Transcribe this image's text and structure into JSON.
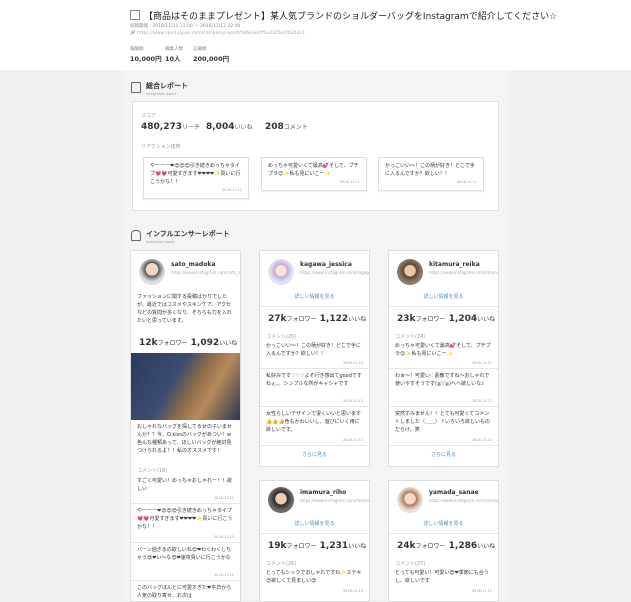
{
  "header": {
    "title": "【商品はそのままプレゼント】某人気ブランドのショルダーバッグをInstagramで紹介してください☆",
    "period": "投稿期間 : 2016/11/11 11:00 ～ 2016/11/12 22:00",
    "url": "🔗 https://www.spirit-japan.com/company/report/586e3e2ff5e2305e1fb20d11",
    "stats": [
      {
        "label": "報酬額",
        "value": "10,000円"
      },
      {
        "label": "募集人数",
        "value": "10人"
      },
      {
        "label": "応募額",
        "value": "200,000円"
      }
    ]
  },
  "summary": {
    "title": "総合レポート",
    "subtitle": "Integrated report",
    "score_label": "スコア",
    "reach": "480,273",
    "reach_unit": "リーチ",
    "likes": "8,004",
    "likes_unit": "いいね",
    "comments": "208",
    "comments_unit": "コメント",
    "reaction_label": "リアクション抜粋",
    "reactions": [
      {
        "text": "やーーー❤😍😍😍引き続きめっちゃタイプ💗💗可愛すぎます❤❤❤❤✨買いに行こうかな！！",
        "date": "2016.11.12"
      },
      {
        "text": "めっちゃ可愛いくて最高💕そして、プチプラ😊✨私も見にいこー✨",
        "date": "2016.11.11"
      },
      {
        "text": "かっこいい〜！この柄が好き！どこで手に入るんですか？欲しい！！",
        "date": "2016.11.11"
      }
    ]
  },
  "influencer": {
    "title": "インフルエンサーレポート",
    "subtitle": "Individual report",
    "detail_link": "詳しい情報を見る",
    "more_link": "さらに見る",
    "follower_unit": "フォロワー",
    "like_unit": "いいね",
    "cards": [
      {
        "name": "sato_madoka",
        "url": "https://www.instagram.com/sato_madoka",
        "desc": "ファッションに関する投稿ばかりでしたが、最近ではコスメやスキンケア、アクセなどの質問が多くなり、そちらも力を入れたいと思っています。",
        "followers": "12k",
        "likes": "1,092",
        "caption": "おしゃれなバッグを探してる女の子いませんか？？今、O.kissのバッグがあつい！w 色んな種類あって、ほしいバッグが絶対見つけられるよ！！私のオススメです！",
        "comment_label": "コメント(18)",
        "comments": [
          {
            "text": "すごく可愛い！めっちゃおしゃれー！！欲しい",
            "date": "2016.11.11"
          },
          {
            "text": "やーーー❤😍😍😍引き続きめっちゃタイプ💗💗可愛すぎます❤❤❤❤✨買いに行こうかな！！",
            "date": "2016.11.12"
          },
          {
            "text": "バーン過ぎるの欲しいね😍❤わくわくしちゃう😍❤い〜な😍❤速攻買いに行こうかな",
            "date": "2016.11.12"
          },
          {
            "text": "このバッグほんとに可愛すぎた❤平日から人気の取り寄せ、お次は"
          }
        ]
      },
      {
        "name": "kagawa_jessica",
        "url": "https://www.instagram.com/kagawa_jessica",
        "followers": "27k",
        "likes": "1,122",
        "comment_label": "コメント(20)",
        "comments": [
          {
            "text": "かっこいい〜！この柄が好き！どこで手に入るんですか？欲しい！！",
            "date": "2016.11.12"
          },
          {
            "text": "私好みです♡♡♡よそ行き感出てgoodですねぇ。。シンプルな所がキャシャです",
            "date": "2016.11.12"
          },
          {
            "text": "女性らしいデザインで凄くいいと思います👍👍👍色もかわいいし、遊びにいく用に欲しいです。",
            "date": "2016.11.12"
          }
        ]
      },
      {
        "name": "kitamura_reika",
        "url": "https://www.instagram.com/kitamura_reika",
        "followers": "23k",
        "likes": "1,204",
        "comment_label": "コメント(24)",
        "comments": [
          {
            "text": "めっちゃ可愛いくて最高💕そして、プチプラ😊✨私も見にいこー✨",
            "date": "2016.11.11"
          },
          {
            "text": "わぁ〜！可愛い♡素敵ですね〜おしゃれで使いやすそうです(≧▽≦)ヘヘ欲しいな♪",
            "date": "2016.11.12"
          },
          {
            "text": "突然すみません！！とても可愛くてコメントしました（＿＿）ゞいろいろ欲しいものだらけ。笑",
            "date": "2016.11.12"
          }
        ]
      },
      {
        "name": "imamura_riho",
        "url": "https://www.instagram.com/imamura_riho",
        "followers": "19k",
        "likes": "1,231",
        "comment_label": "コメント(26)",
        "comments": [
          {
            "text": "とってもシックでおしゃれですね✨ステキ😍欲しくて見ましい😍",
            "date": "2016.11.12"
          }
        ]
      },
      {
        "name": "yamada_sanae",
        "url": "https://www.instagram.com/yamada_sanae",
        "followers": "24k",
        "likes": "1,286",
        "comment_label": "コメント(27)",
        "comments": [
          {
            "text": "とっても可愛い！可愛い😍❤季節にも合うし、欲しいです",
            "date": "2016.11.12"
          }
        ]
      }
    ]
  },
  "colors": {
    "link": "#4a90c8",
    "background": "#f1f1f1"
  }
}
